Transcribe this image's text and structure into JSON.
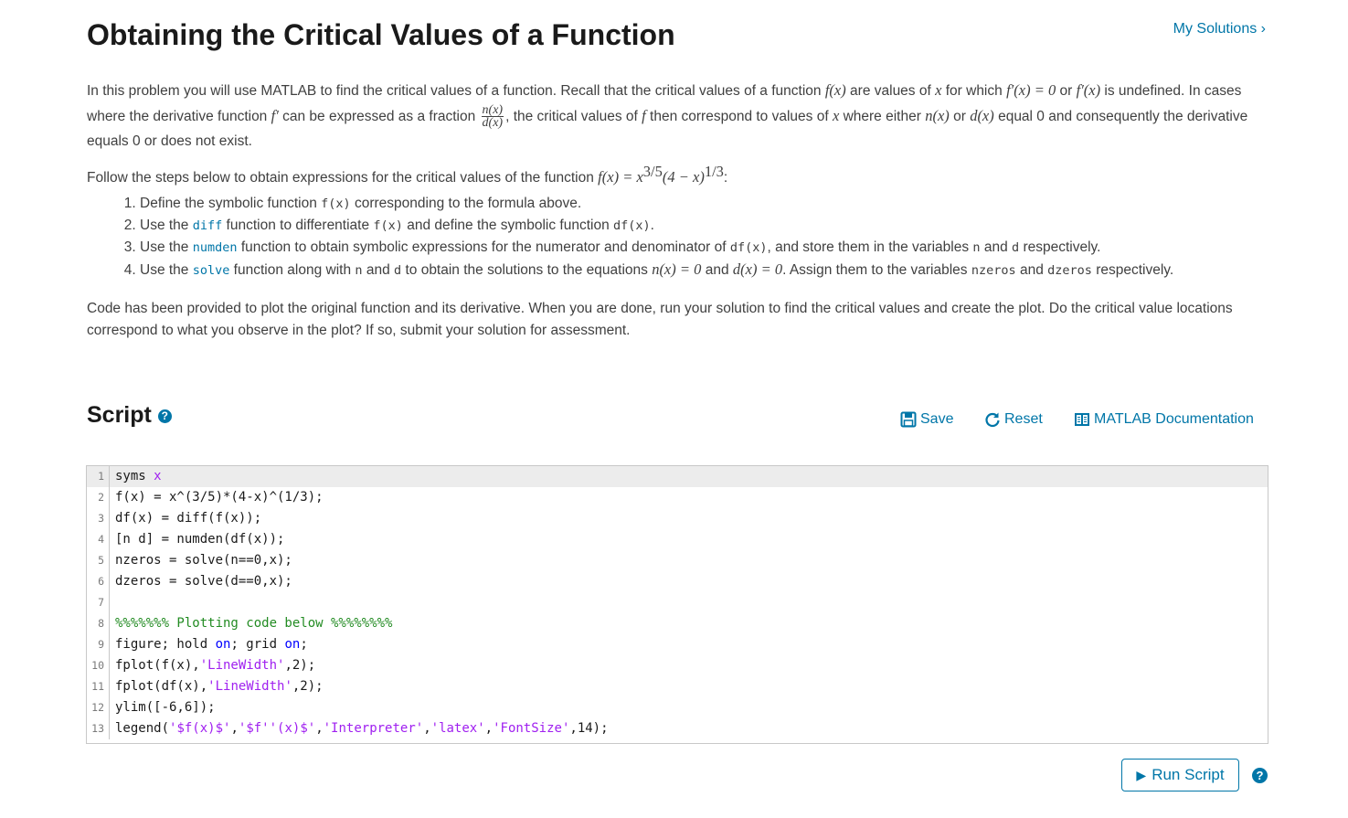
{
  "page": {
    "title": "Obtaining the Critical Values of a Function",
    "my_solutions_label": "My Solutions",
    "my_solutions_chevron": "›"
  },
  "description": {
    "p1": {
      "t1": "In this problem you will use MATLAB to find the critical values of a function. Recall that the critical values of a function ",
      "m_fx": "f(x)",
      "t2": " are values of ",
      "m_x": "x",
      "t3": " for which ",
      "m_fp0": "f′(x) = 0",
      "t4": " or ",
      "m_fp": "f′(x)",
      "t5": " is undefined. In cases where the derivative function ",
      "m_fprime": "f′",
      "t6": " can be expressed as a fraction ",
      "frac_num": "n(x)",
      "frac_den": "d(x)",
      "t7": ", the critical values of ",
      "m_f": "f",
      "t8": " then correspond to values of ",
      "m_x2": "x",
      "t9": " where either ",
      "m_nx": "n(x)",
      "t10": " or ",
      "m_dx": "d(x)",
      "t11": " equal 0 and consequently the derivative equals 0 or does not exist."
    },
    "p2": {
      "t1": "Follow the steps below to obtain expressions for the critical values of the function ",
      "m_formula": "f(x) = x",
      "m_exp1": "3/5",
      "m_mid": "(4 − x)",
      "m_exp2": "1/3",
      "t2": ":"
    },
    "steps": [
      {
        "a": "Define the symbolic function ",
        "c1": "f(x)",
        "b": " corresponding to the formula above."
      },
      {
        "a": "Use the ",
        "fn": "diff",
        "b": " function to differentiate ",
        "c1": "f(x)",
        "c": " and define the symbolic function ",
        "c2": "df(x)",
        "d": "."
      },
      {
        "a": "Use the ",
        "fn": "numden",
        "b": " function to obtain symbolic expressions for the numerator and denominator of ",
        "c1": "df(x)",
        "c": ", and store them in the variables ",
        "c2": "n",
        "d": " and ",
        "c3": "d",
        "e": " respectively."
      },
      {
        "a": "Use the ",
        "fn": "solve",
        "b": " function along with ",
        "c1": "n",
        "c": " and ",
        "c2": "d",
        "d": " to obtain the solutions to the equations ",
        "m1": "n(x) = 0",
        "e": " and ",
        "m2": "d(x) = 0",
        "f": ". Assign them to the variables ",
        "c3": "nzeros",
        "g": " and ",
        "c4": "dzeros",
        "h": " respectively."
      }
    ],
    "p3": "Code has been provided to plot the original function and its derivative. When you are done, run your solution to find the critical values and create the plot. Do the critical value locations correspond to what you observe in the plot? If so, submit your solution for assessment."
  },
  "script": {
    "title": "Script",
    "help_icon": "?",
    "save_label": "Save",
    "reset_label": "Reset",
    "docs_label": "MATLAB Documentation",
    "lines": [
      {
        "n": "1",
        "parts": [
          [
            "syms ",
            ""
          ],
          [
            "x",
            "var"
          ]
        ]
      },
      {
        "n": "2",
        "parts": [
          [
            "f(x) = x^(3/5)*(4-x)^(1/3);",
            ""
          ]
        ]
      },
      {
        "n": "3",
        "parts": [
          [
            "df(x) = diff(f(x));",
            ""
          ]
        ]
      },
      {
        "n": "4",
        "parts": [
          [
            "[n d] = numden(df(x));",
            ""
          ]
        ]
      },
      {
        "n": "5",
        "parts": [
          [
            "nzeros = solve(n==0,x);",
            ""
          ]
        ]
      },
      {
        "n": "6",
        "parts": [
          [
            "dzeros = solve(d==0,x);",
            ""
          ]
        ]
      },
      {
        "n": "7",
        "parts": []
      },
      {
        "n": "8",
        "parts": [
          [
            "%%%%%%% Plotting code below %%%%%%%%",
            "com"
          ]
        ]
      },
      {
        "n": "9",
        "parts": [
          [
            "figure; hold ",
            ""
          ],
          [
            "on",
            "kw"
          ],
          [
            "; grid ",
            ""
          ],
          [
            "on",
            "kw"
          ],
          [
            ";",
            ""
          ]
        ]
      },
      {
        "n": "10",
        "parts": [
          [
            "fplot(f(x),",
            ""
          ],
          [
            "'LineWidth'",
            "str"
          ],
          [
            ",2);",
            ""
          ]
        ]
      },
      {
        "n": "11",
        "parts": [
          [
            "fplot(df(x),",
            ""
          ],
          [
            "'LineWidth'",
            "str"
          ],
          [
            ",2);",
            ""
          ]
        ]
      },
      {
        "n": "12",
        "parts": [
          [
            "ylim([-6,6]);",
            ""
          ]
        ]
      },
      {
        "n": "13",
        "parts": [
          [
            "legend(",
            ""
          ],
          [
            "'$f(x)$'",
            "str"
          ],
          [
            ",",
            ""
          ],
          [
            "'$f''(x)$'",
            "str"
          ],
          [
            ",",
            ""
          ],
          [
            "'Interpreter'",
            "str"
          ],
          [
            ",",
            ""
          ],
          [
            "'latex'",
            "str"
          ],
          [
            ",",
            ""
          ],
          [
            "'FontSize'",
            "str"
          ],
          [
            ",14);",
            ""
          ]
        ]
      }
    ],
    "run_label": "Run Script",
    "run_icon": "▶"
  },
  "colors": {
    "accent": "#0076a8",
    "keyword": "#0000ff",
    "string": "#a020f0",
    "comment": "#228b22"
  }
}
